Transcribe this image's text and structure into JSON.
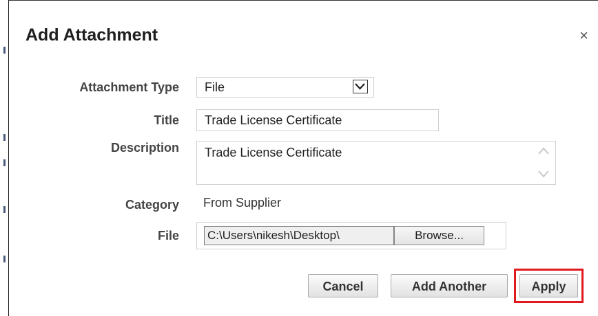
{
  "dialog": {
    "title": "Add Attachment",
    "close_symbol": "×"
  },
  "form": {
    "attachment_type": {
      "label": "Attachment Type",
      "value": "File"
    },
    "title": {
      "label": "Title",
      "value": "Trade License Certificate"
    },
    "description": {
      "label": "Description",
      "value": "Trade License Certificate"
    },
    "category": {
      "label": "Category",
      "value": "From Supplier"
    },
    "file": {
      "label": "File",
      "path": "C:\\Users\\nikesh\\Desktop\\",
      "browse_label": "Browse..."
    }
  },
  "actions": {
    "cancel_label": "Cancel",
    "add_another_label": "Add Another",
    "apply_label": "Apply"
  },
  "colors": {
    "highlight": "#e0191e"
  }
}
